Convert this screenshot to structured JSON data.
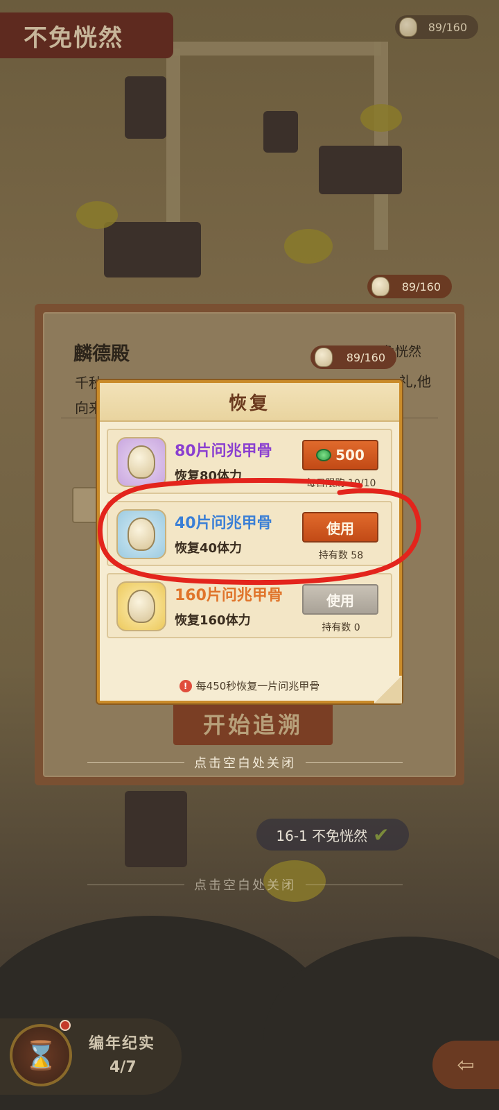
{
  "scene": {
    "top_title": "不免恍然",
    "top_counter": "89/160",
    "mid_counter": "89/160"
  },
  "outer_dialog": {
    "title": "麟德殿",
    "subtitle": "不免恍然",
    "text_left_1": "千秋",
    "text_left_2": "向来",
    "text_right": "礼,他",
    "counter": "89/160",
    "start_button": "开始追溯",
    "close_hint": "点击空白处关闭"
  },
  "recover_panel": {
    "title": "恢复",
    "items": [
      {
        "name": "80片问兆甲骨",
        "desc": "恢复80体力",
        "button": "500",
        "button_type": "buy",
        "sub": "每日限购 10/10",
        "thumb_color": "purple",
        "name_color": "#8a3fd0"
      },
      {
        "name": "40片问兆甲骨",
        "desc": "恢复40体力",
        "button": "使用",
        "button_type": "use",
        "sub": "持有数 58",
        "thumb_color": "blue",
        "name_color": "#3a7fd6"
      },
      {
        "name": "160片问兆甲骨",
        "desc": "恢复160体力",
        "button": "使用",
        "button_type": "disabled",
        "sub": "持有数 0",
        "thumb_color": "gold",
        "name_color": "#e0742a"
      }
    ],
    "footer_note": "每450秒恢复一片问兆甲骨"
  },
  "chapter_badge": "16-1 不免恍然",
  "second_close_hint": "点击空白处关闭",
  "chronicle": {
    "label": "编年纪实",
    "progress": "4/7"
  },
  "colors": {
    "accent_orange": "#c24a16",
    "panel_border": "#c98b2a",
    "annotation_red": "#e3241c"
  }
}
